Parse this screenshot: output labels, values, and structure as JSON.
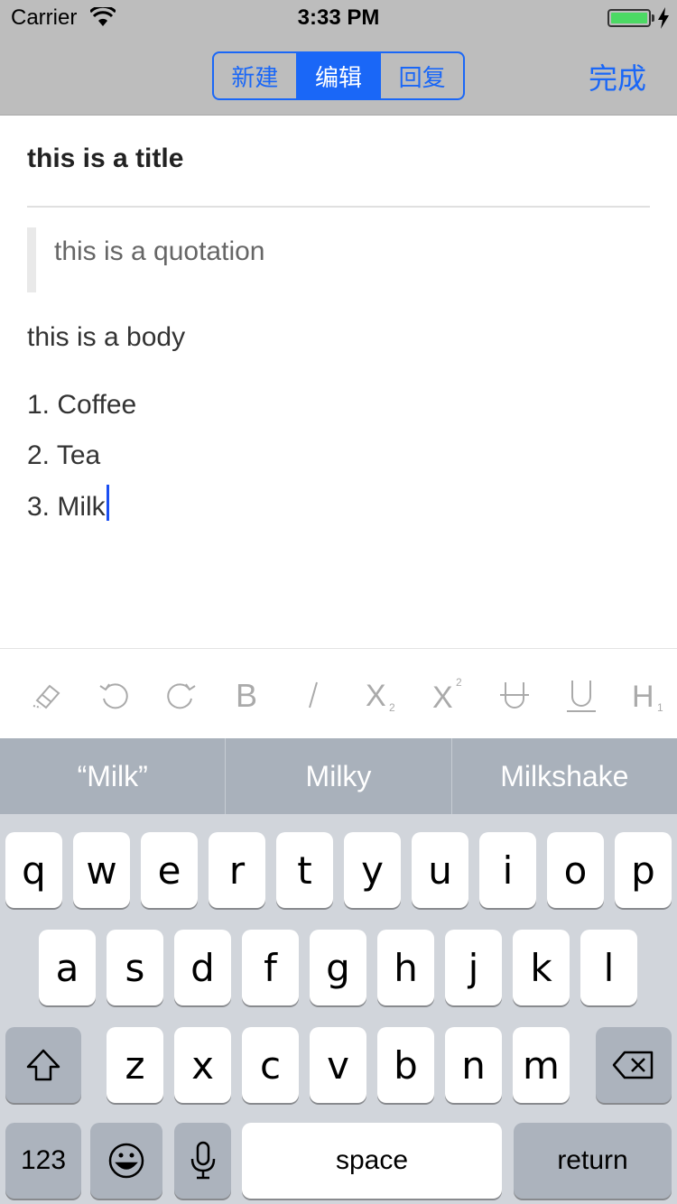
{
  "status": {
    "carrier": "Carrier",
    "time": "3:33 PM",
    "battery_level": 1.0
  },
  "nav": {
    "segments": [
      "新建",
      "编辑",
      "回复"
    ],
    "active_segment": 1,
    "done_label": "完成"
  },
  "editor": {
    "title": "this is a title",
    "quote": "this is a quotation",
    "body": "this is a body",
    "list_items": [
      "1. Coffee",
      "2. Tea",
      "3. Milk"
    ]
  },
  "toolbar": {
    "buttons": [
      {
        "name": "eraser-icon"
      },
      {
        "name": "undo-icon"
      },
      {
        "name": "redo-icon"
      },
      {
        "name": "bold-icon",
        "glyph": "B"
      },
      {
        "name": "italic-icon",
        "glyph": "I"
      },
      {
        "name": "subscript-icon",
        "glyph": "X",
        "sub": "2"
      },
      {
        "name": "superscript-icon",
        "glyph": "X",
        "sup": "2"
      },
      {
        "name": "strikethrough-icon",
        "glyph": "U"
      },
      {
        "name": "underline-icon",
        "glyph": "U"
      },
      {
        "name": "heading-icon",
        "glyph": "H",
        "sub": "1"
      }
    ]
  },
  "keyboard": {
    "predictions": [
      "“Milk”",
      "Milky",
      "Milkshake"
    ],
    "row1": [
      "q",
      "w",
      "e",
      "r",
      "t",
      "y",
      "u",
      "i",
      "o",
      "p"
    ],
    "row2": [
      "a",
      "s",
      "d",
      "f",
      "g",
      "h",
      "j",
      "k",
      "l"
    ],
    "row3": [
      "z",
      "x",
      "c",
      "v",
      "b",
      "n",
      "m"
    ],
    "numbers_label": "123",
    "space_label": "space",
    "return_label": "return",
    "icons": {
      "shift": "shift-icon",
      "delete": "delete-icon",
      "emoji": "emoji-icon",
      "mic": "microphone-icon"
    }
  },
  "colors": {
    "accent": "#1a67f7",
    "nav_bg": "#bdbdbd",
    "keyboard_bg": "#d1d5db",
    "cursor": "#1a4ff2",
    "battery": "#4cd964"
  }
}
